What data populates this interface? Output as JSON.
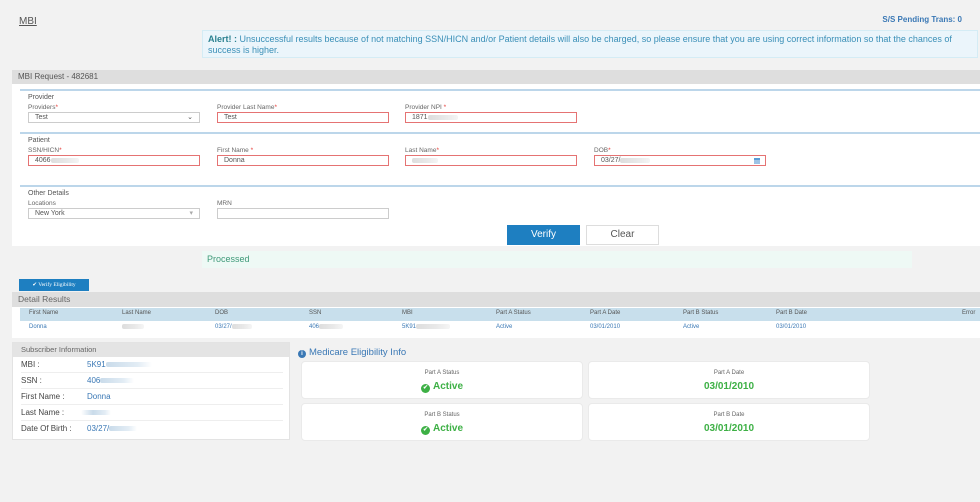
{
  "header": {
    "title": "MBI",
    "pending": "S/S Pending Trans: 0",
    "alert_prefix": "Alert! :",
    "alert_text": " Unsuccessful results because of not matching SSN/HICN and/or Patient details will also be charged, so please ensure that you are using correct information so that the chances of success is higher."
  },
  "request": {
    "title": "MBI Request - 482681",
    "provider": {
      "section": "Provider",
      "providers_label": "Providers",
      "providers_value": "Test",
      "last_name_label": "Provider Last Name",
      "last_name_value": "Test",
      "npi_label": "Provider NPI",
      "npi_value": "1871"
    },
    "patient": {
      "section": "Patient",
      "ssn_label": "SSN/HICN",
      "ssn_value": "4066",
      "first_name_label": "First Name",
      "first_name_value": "Donna",
      "last_name_label": "Last Name",
      "last_name_value": "",
      "dob_label": "DOB",
      "dob_value": "03/27/"
    },
    "other": {
      "section": "Other Details",
      "locations_label": "Locations",
      "locations_value": "New York",
      "mrn_label": "MRN",
      "mrn_value": ""
    },
    "verify_label": "Verify",
    "clear_label": "Clear"
  },
  "status": "Processed",
  "verify_eligibility_label": "✔ Verify Eligibility",
  "detail": {
    "title": "Detail Results",
    "columns": [
      "First Name",
      "Last Name",
      "DOB",
      "SSN",
      "MBI",
      "Part A Status",
      "Part A Date",
      "Part B Status",
      "Part B Date",
      "Error"
    ],
    "rows": [
      [
        "Donna",
        "",
        "03/27/",
        "406",
        "5K91",
        "Active",
        "03/01/2010",
        "Active",
        "03/01/2010",
        ""
      ]
    ]
  },
  "subscriber": {
    "title": "Subscriber Information",
    "rows": [
      {
        "label": "MBI :",
        "value": "5K91"
      },
      {
        "label": "SSN :",
        "value": "406"
      },
      {
        "label": "First Name :",
        "value": "Donna"
      },
      {
        "label": "Last Name :",
        "value": ""
      },
      {
        "label": "Date Of Birth :",
        "value": "03/27/"
      }
    ]
  },
  "medicare": {
    "title": "Medicare Eligibility Info",
    "cards": [
      {
        "label": "Part A Status",
        "value": "Active"
      },
      {
        "label": "Part A Date",
        "value": "03/01/2010"
      },
      {
        "label": "Part B Status",
        "value": "Active"
      },
      {
        "label": "Part B Date",
        "value": "03/01/2010"
      }
    ]
  },
  "colors": {
    "primary": "#1e7fc1",
    "link": "#3a78b5",
    "success": "#3db045",
    "error_border": "#e57373"
  }
}
